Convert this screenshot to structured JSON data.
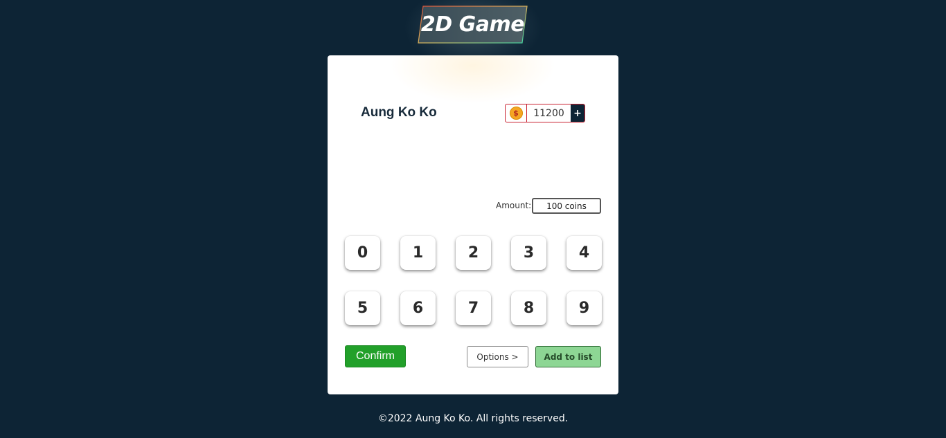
{
  "header": {
    "logo_text": "2D Game"
  },
  "user": {
    "name": "Aung Ko Ko"
  },
  "wallet": {
    "coin_icon": "dollar-coin-icon",
    "coin_symbol": "$",
    "balance": "11200",
    "add_label": "+"
  },
  "amount": {
    "label": "Amount:",
    "value": "100 coins"
  },
  "keypad": {
    "digits": [
      "0",
      "1",
      "2",
      "3",
      "4",
      "5",
      "6",
      "7",
      "8",
      "9"
    ]
  },
  "actions": {
    "confirm_label": "Confirm",
    "options_label": "Options >",
    "add_to_list_label": "Add to list"
  },
  "footer": {
    "copyright": "©2022 Aung Ko Ko. All rights reserved."
  },
  "colors": {
    "background": "#0d2435",
    "confirm": "#22a02a",
    "add_to_list": "#8dd694",
    "wallet_border": "#c8202f"
  }
}
